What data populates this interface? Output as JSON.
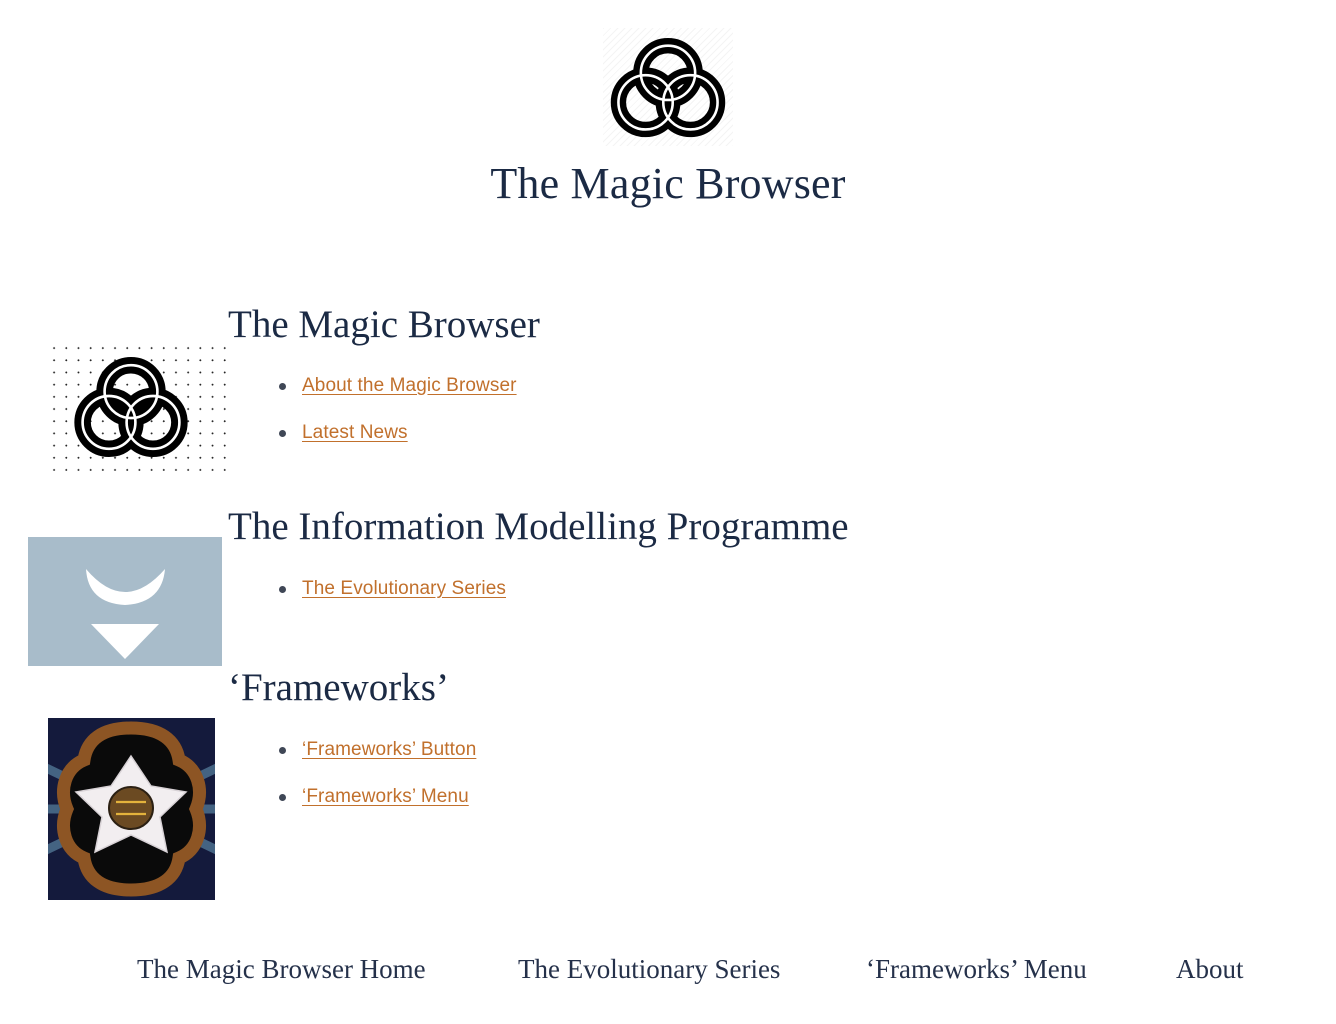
{
  "site": {
    "title": "The Magic Browser",
    "logo_icon": "celtic-triquetra-knot-icon"
  },
  "sections": [
    {
      "heading": "The Magic Browser",
      "figure_icon": "celtic-knot-on-dot-grid-image",
      "links": [
        {
          "label": "About the Magic Browser"
        },
        {
          "label": "Latest News"
        }
      ]
    },
    {
      "heading": "The Information Modelling Programme",
      "figure_icon": "slate-crescent-and-triangle-image",
      "links": [
        {
          "label": "The Evolutionary Series"
        }
      ]
    },
    {
      "heading": "‘Frameworks’",
      "figure_icon": "stained-glass-rose-image",
      "links": [
        {
          "label": "‘Frameworks’ Button"
        },
        {
          "label": "‘Frameworks’ Menu"
        }
      ]
    }
  ],
  "footer_nav": [
    {
      "label": "The Magic Browser Home"
    },
    {
      "label": "The Evolutionary Series"
    },
    {
      "label": "‘Frameworks’ Menu"
    },
    {
      "label": "About"
    }
  ],
  "colors": {
    "page_background": "#ffffff",
    "heading_navy": "#1b2a44",
    "link_rust": "#c1702c",
    "bullet_grey": "#3f4756",
    "slate_panel": "#a8bcca",
    "rose_navy": "#0e1433",
    "rose_copper": "#8d5524"
  }
}
